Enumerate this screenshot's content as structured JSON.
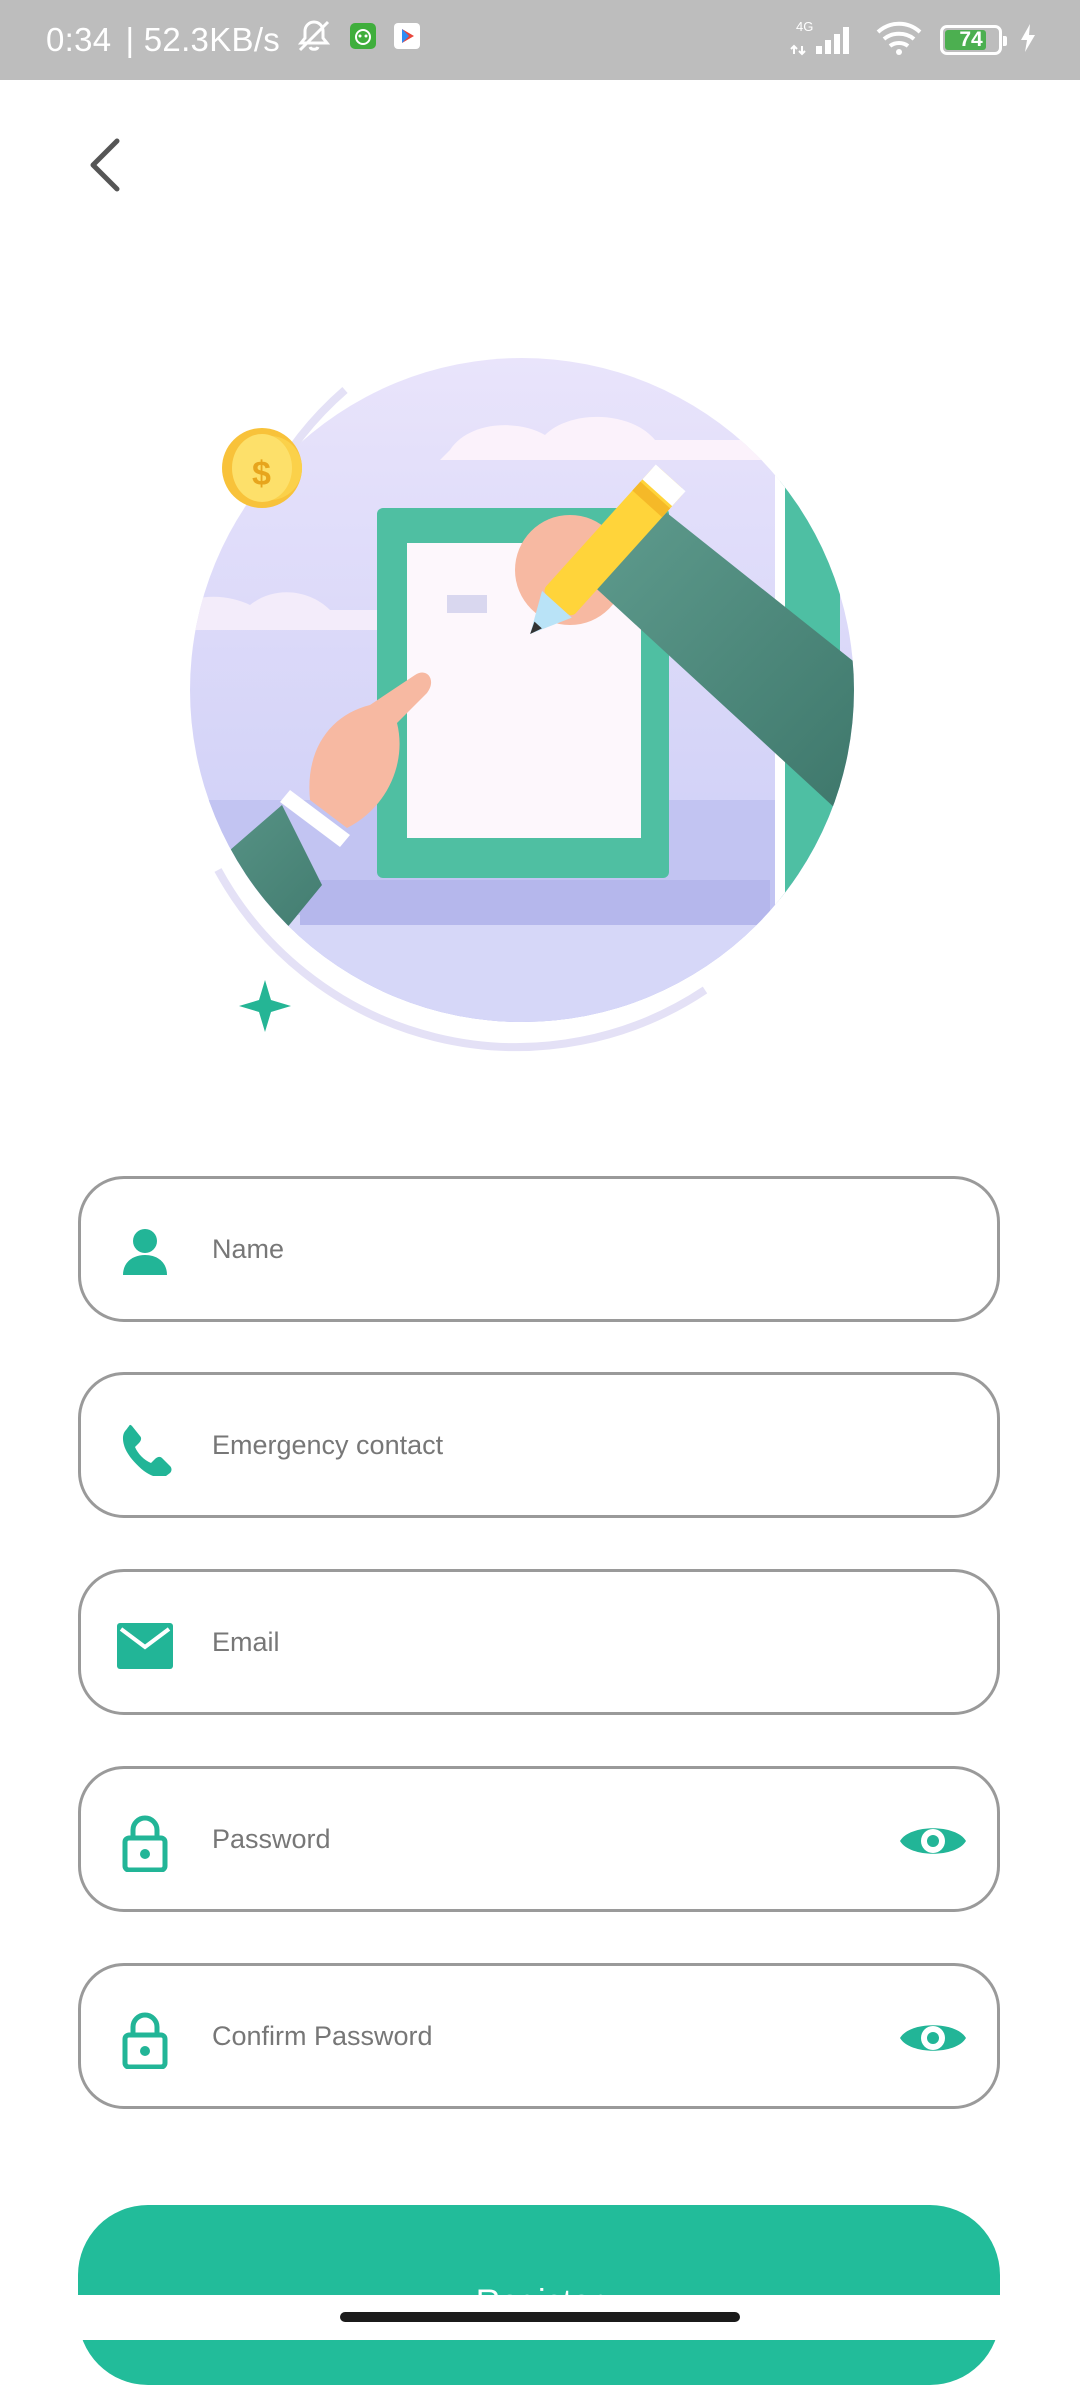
{
  "status_bar": {
    "time": "0:34",
    "net_speed": "| 52.3KB/s",
    "network_label": "4G",
    "battery_level": "74"
  },
  "colors": {
    "accent": "#22bc9a",
    "icon": "#22b597",
    "border": "#9a9a9a"
  },
  "form": {
    "fields": [
      {
        "placeholder": "Name",
        "icon": "person-icon"
      },
      {
        "placeholder": "Emergency contact",
        "icon": "phone-icon"
      },
      {
        "placeholder": "Email",
        "icon": "mail-icon"
      },
      {
        "placeholder": "Password",
        "icon": "lock-icon",
        "toggle_icon": "eye-icon"
      },
      {
        "placeholder": "Confirm Password",
        "icon": "lock-icon",
        "toggle_icon": "eye-icon"
      }
    ],
    "submit_label": "Register"
  }
}
